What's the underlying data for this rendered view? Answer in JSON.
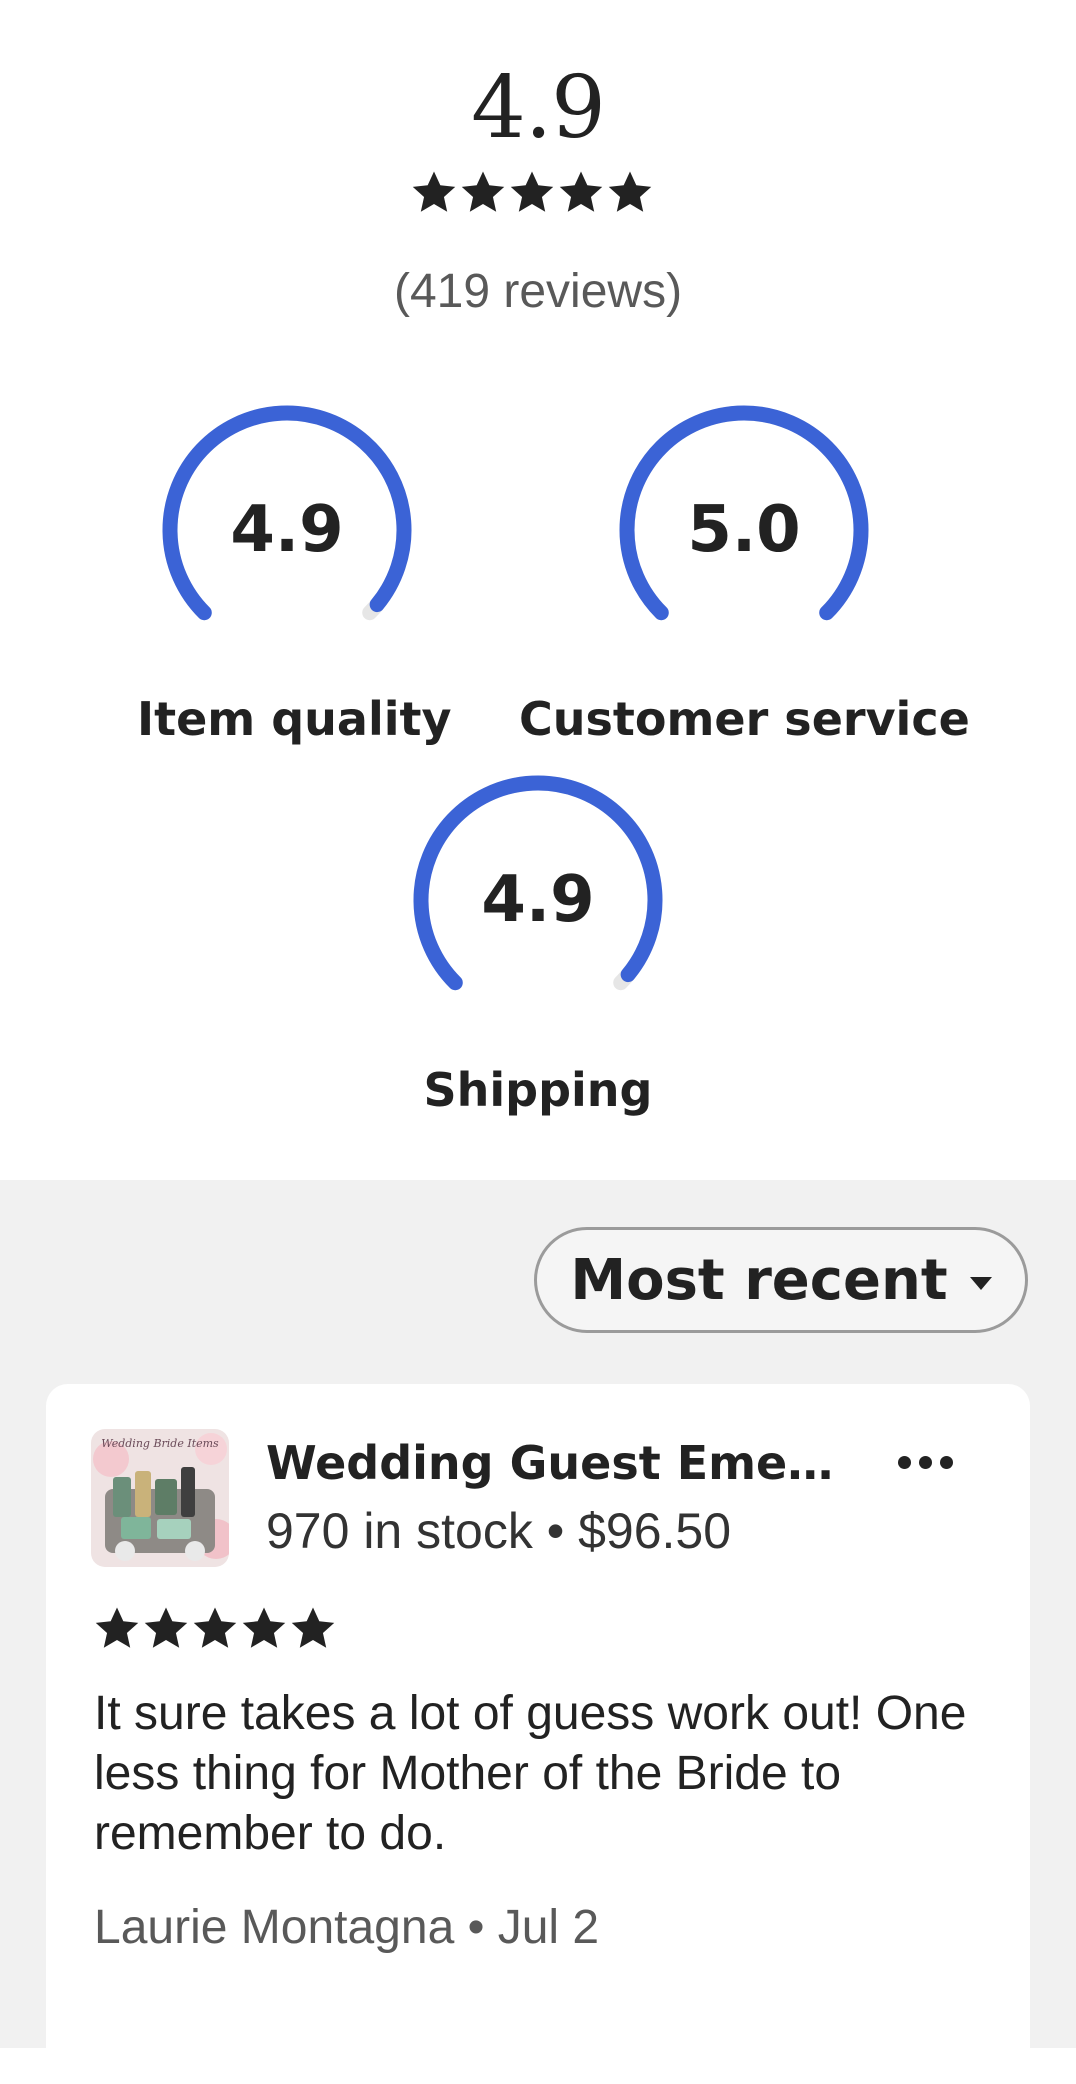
{
  "summary": {
    "overall_rating": "4.9",
    "stars_filled": 5,
    "stars_total": 5,
    "review_count": "(419 reviews)"
  },
  "scores": {
    "item_quality": {
      "value": "4.9",
      "label": "Item quality",
      "fraction": 0.98
    },
    "customer_service": {
      "value": "5.0",
      "label": "Customer service",
      "fraction": 1.0
    },
    "shipping": {
      "value": "4.9",
      "label": "Shipping",
      "fraction": 0.98
    }
  },
  "sort": {
    "label": "Most recent"
  },
  "review": {
    "product_title": "Wedding Guest Emer...",
    "product_meta": "970 in stock • $96.50",
    "thumbnail_caption": "Wedding Bride Items",
    "stars_filled": 5,
    "text": "It sure takes a lot of guess work out! One less thing for Mother of the Bride to remember to do.",
    "author_date": "Laurie Montagna • Jul 2"
  },
  "colors": {
    "gauge_fill": "#3b63d6",
    "gauge_track": "#e6e6e6",
    "star": "#222222",
    "gray_background": "#f1f1f1"
  }
}
